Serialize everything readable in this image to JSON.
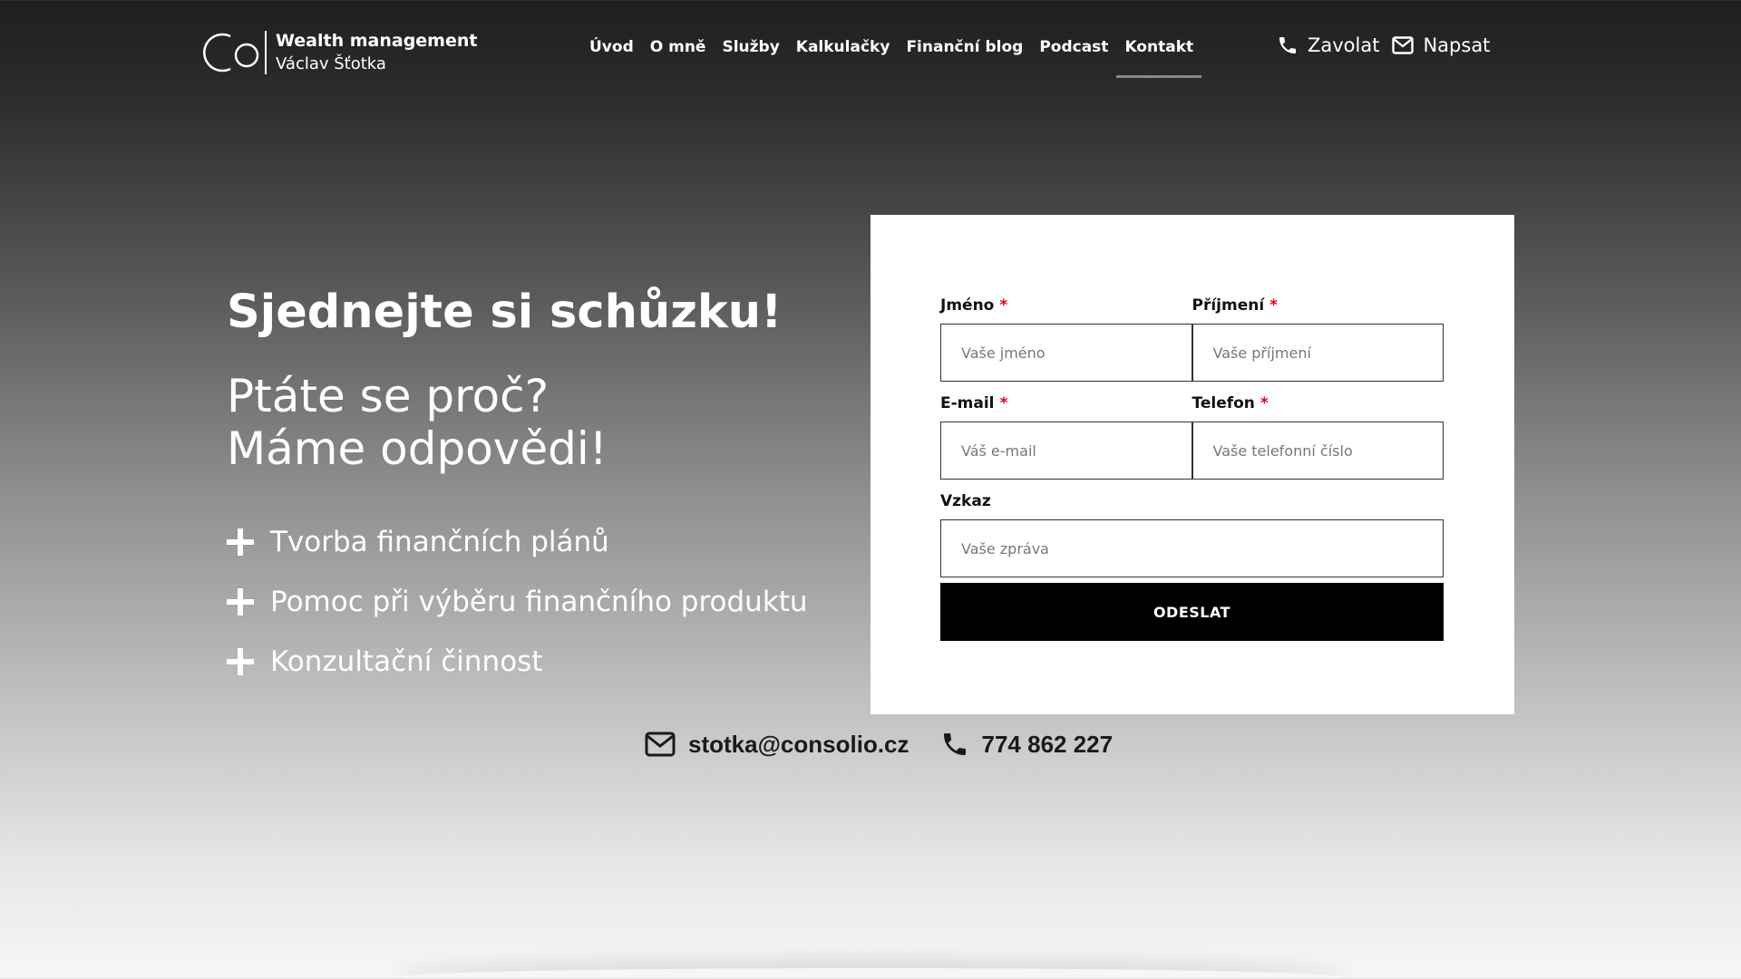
{
  "header": {
    "logo_title": "Wealth management",
    "logo_subtitle": "Václav Šťotka",
    "nav": [
      "Úvod",
      "O mně",
      "Služby",
      "Kalkulačky",
      "Finanční blog",
      "Podcast",
      "Kontakt"
    ],
    "active_nav": "Kontakt",
    "call_label": "Zavolat",
    "write_label": "Napsat"
  },
  "hero": {
    "title": "Sjednejte si schůzku!",
    "subtitle_line1": "Ptáte se proč?",
    "subtitle_line2": "Máme odpovědi!",
    "features": [
      "Tvorba finančních plánů",
      "Pomoc při výběru finančního produktu",
      "Konzultační činnost"
    ]
  },
  "form": {
    "first_name_label": "Jméno",
    "first_name_placeholder": "Vaše jméno",
    "last_name_label": "Příjmení",
    "last_name_placeholder": "Vaše příjmení",
    "email_label": "E-mail",
    "email_placeholder": "Váš e-mail",
    "phone_label": "Telefon",
    "phone_placeholder": "Vaše telefonní číslo",
    "message_label": "Vzkaz",
    "message_placeholder": "Vaše zpráva",
    "required_mark": "*",
    "submit_label": "ODESLAT"
  },
  "contact": {
    "email": "stotka@consolio.cz",
    "phone": "774 862 227"
  },
  "icons": {
    "phone": "phone-icon",
    "mail": "envelope-icon",
    "plus": "plus-icon"
  },
  "colors": {
    "required": "#e0001a",
    "button_bg": "#000000",
    "nav_underline": "#8a8a8a"
  }
}
